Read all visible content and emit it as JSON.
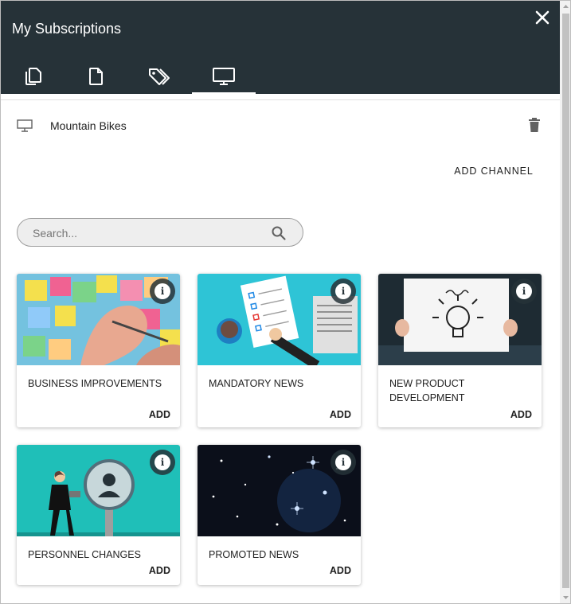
{
  "header": {
    "title": "My Subscriptions",
    "close_icon": "close-icon",
    "tabs": [
      {
        "icon": "copy-icon",
        "active": false
      },
      {
        "icon": "document-icon",
        "active": false
      },
      {
        "icon": "tags-icon",
        "active": false
      },
      {
        "icon": "monitor-icon",
        "active": true
      }
    ]
  },
  "channel": {
    "icon": "monitor-icon",
    "name": "Mountain Bikes",
    "delete_icon": "trash-icon"
  },
  "add_channel_label": "ADD CHANNEL",
  "search": {
    "placeholder": "Search...",
    "value": ""
  },
  "cards": [
    {
      "name": "BUSINESS IMPROVEMENTS",
      "add_label": "ADD",
      "image": "sticky-notes-photo"
    },
    {
      "name": "MANDATORY NEWS",
      "add_label": "ADD",
      "image": "checklist-illustration"
    },
    {
      "name": "NEW PRODUCT DEVELOPMENT",
      "add_label": "ADD",
      "image": "idea-lightbulb-photo"
    },
    {
      "name": "PERSONNEL CHANGES",
      "add_label": "ADD",
      "image": "magnifier-person-illustration"
    },
    {
      "name": "PROMOTED NEWS",
      "add_label": "ADD",
      "image": "starfield-photo"
    }
  ],
  "colors": {
    "header_bg": "#263238",
    "accent_teal": "#26c6c6",
    "text": "#212121"
  }
}
